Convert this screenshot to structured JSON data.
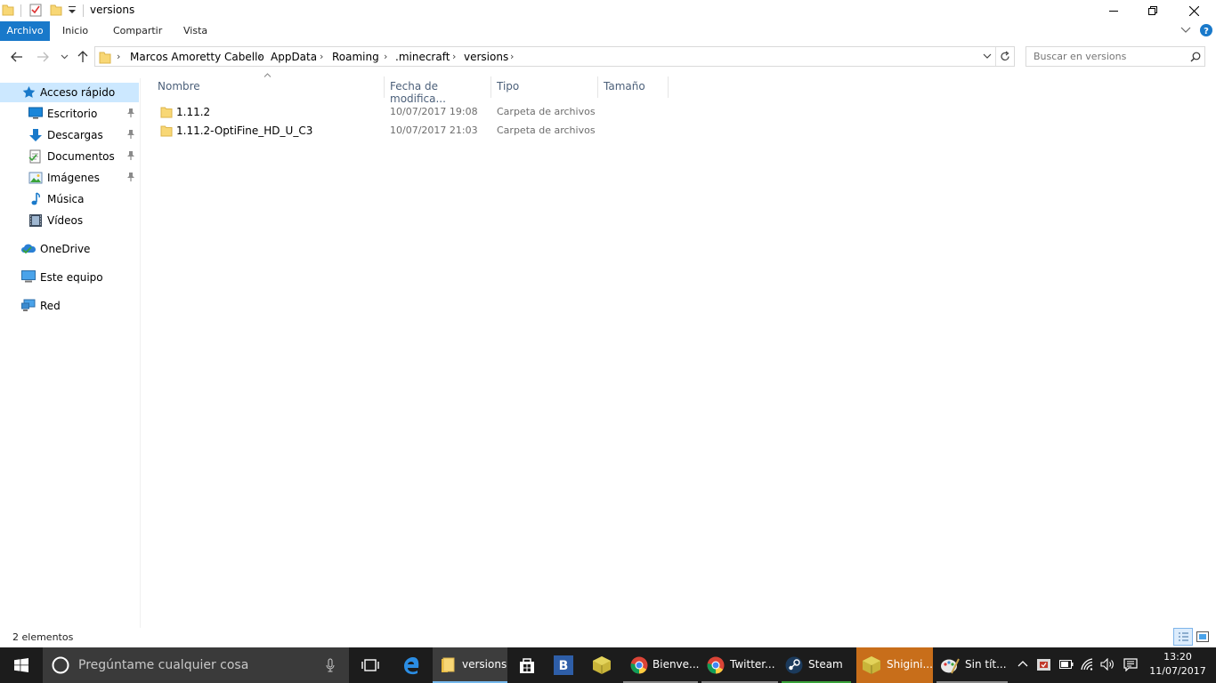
{
  "window": {
    "title": "versions"
  },
  "ribbon": {
    "tabs": [
      {
        "label": "Archivo"
      },
      {
        "label": "Inicio"
      },
      {
        "label": "Compartir"
      },
      {
        "label": "Vista"
      }
    ]
  },
  "address": {
    "crumbs": [
      "Marcos Amoretty Cabello",
      "AppData",
      "Roaming",
      ".minecraft",
      "versions"
    ]
  },
  "search": {
    "placeholder": "Buscar en versions"
  },
  "nav": {
    "quick_access": "Acceso rápido",
    "items": [
      {
        "label": "Escritorio",
        "icon": "desktop-icon",
        "pinned": true
      },
      {
        "label": "Descargas",
        "icon": "download-icon",
        "pinned": true
      },
      {
        "label": "Documentos",
        "icon": "documents-icon",
        "pinned": true
      },
      {
        "label": "Imágenes",
        "icon": "pictures-icon",
        "pinned": true
      },
      {
        "label": "Música",
        "icon": "music-icon",
        "pinned": false
      },
      {
        "label": "Vídeos",
        "icon": "video-icon",
        "pinned": false
      }
    ],
    "onedrive": "OneDrive",
    "this_pc": "Este equipo",
    "network": "Red"
  },
  "columns": {
    "name": "Nombre",
    "date": "Fecha de modifica...",
    "type": "Tipo",
    "size": "Tamaño"
  },
  "files": [
    {
      "name": "1.11.2",
      "date": "10/07/2017 19:08",
      "type": "Carpeta de archivos"
    },
    {
      "name": "1.11.2-OptiFine_HD_U_C3",
      "date": "10/07/2017 21:03",
      "type": "Carpeta de archivos"
    }
  ],
  "status": {
    "count": "2 elementos"
  },
  "taskbar": {
    "search_placeholder": "Pregúntame cualquier cosa",
    "apps": [
      {
        "label": "versions",
        "icon": "file-explorer-icon"
      },
      {
        "label": "Bienve...",
        "icon": "chrome-icon"
      },
      {
        "label": "Twitter...",
        "icon": "chrome-icon"
      },
      {
        "label": "Steam",
        "icon": "steam-icon"
      },
      {
        "label": "Shigini...",
        "icon": "minecraft-icon"
      },
      {
        "label": "Sin tít...",
        "icon": "paint-icon"
      }
    ],
    "time": "13:20",
    "date": "11/07/2017"
  },
  "colors": {
    "accent": "#1979ca",
    "selection": "#cce8ff",
    "folder": "#f8d775",
    "taskbar": "#1c1c1c"
  }
}
